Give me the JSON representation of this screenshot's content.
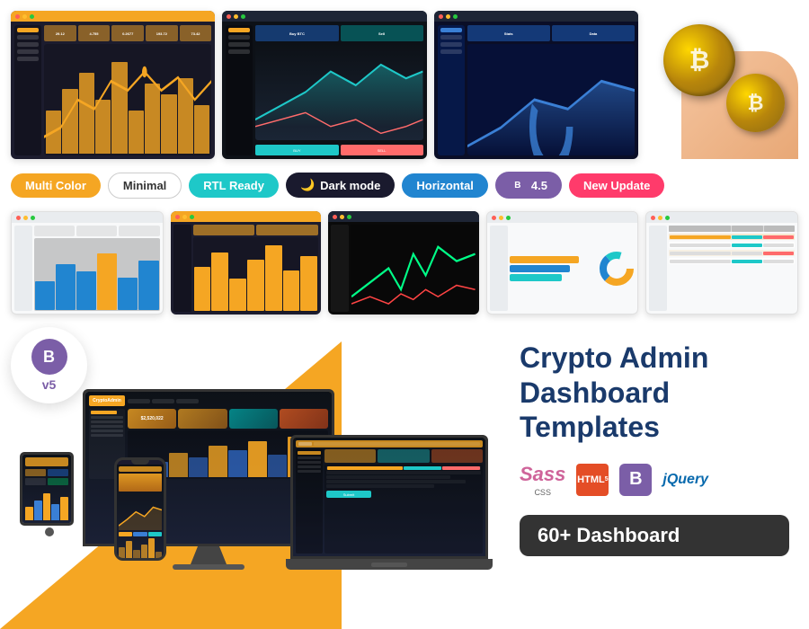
{
  "badges": {
    "multicolor": "Multi Color",
    "minimal": "Minimal",
    "rtl": "RTL Ready",
    "darkmode": "Dark mode",
    "horizontal": "Horizontal",
    "bootstrap": "4.5",
    "newupdate": "New Update"
  },
  "product": {
    "title": "Crypto Admin Dashboard Templates",
    "dashboard_count": "60+ Dashboard",
    "bootstrap_version": "v5"
  },
  "tech": {
    "sass": "Sass",
    "css_label": "CSS",
    "html_label": "5",
    "jquery_label": "jQuery"
  },
  "top_screenshots": [
    {
      "id": "sc1",
      "theme": "orange"
    },
    {
      "id": "sc2",
      "theme": "dark"
    },
    {
      "id": "sc3",
      "theme": "blue-dark"
    }
  ],
  "middle_screenshots": [
    {
      "id": "msc1",
      "theme": "light"
    },
    {
      "id": "msc2",
      "theme": "dark-orange"
    },
    {
      "id": "msc3",
      "theme": "black"
    },
    {
      "id": "msc4",
      "theme": "light2"
    },
    {
      "id": "msc5",
      "theme": "light3"
    }
  ],
  "colors": {
    "multicolor": "#f5a623",
    "rtl": "#1ec8c8",
    "dark": "#1a1a2e",
    "horizontal": "#2185d0",
    "bootstrap": "#7b5ea7",
    "newupdate": "#ff3b6b",
    "title": "#1a3a6b",
    "sass": "#cf649a",
    "html5": "#e44d26",
    "jquery": "#0769ad"
  }
}
